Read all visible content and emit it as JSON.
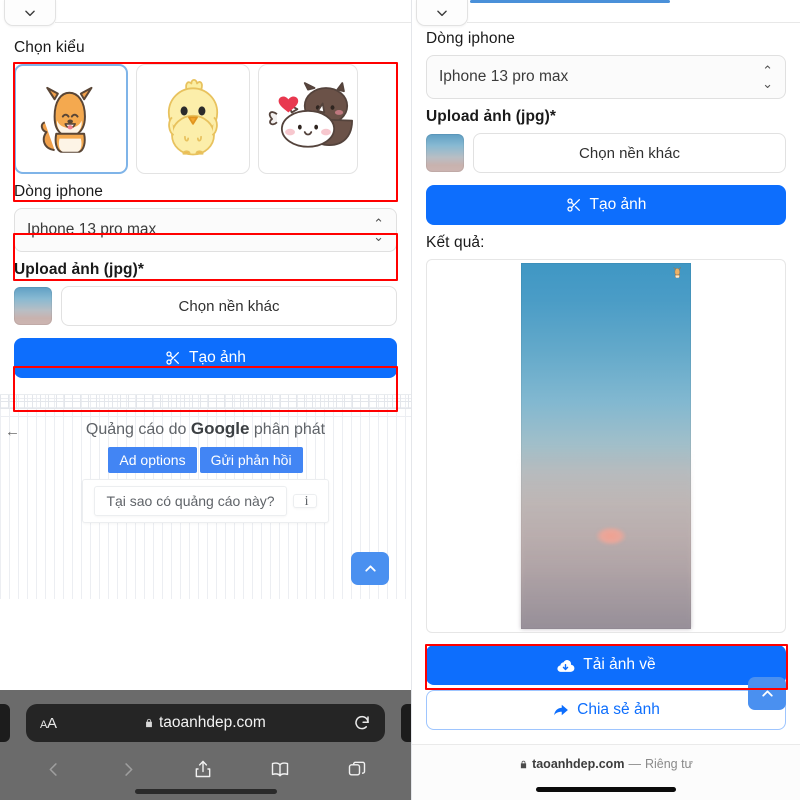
{
  "left_panel": {
    "tab": {
      "chevron_icon": "chevron-down-icon"
    },
    "style_label": "Chọn kiểu",
    "stickers": [
      {
        "name": "shiba-dog-sticker",
        "selected": true
      },
      {
        "name": "yellow-chick-sticker",
        "selected": false
      },
      {
        "name": "cat-couple-sticker",
        "selected": false
      }
    ],
    "iphone_label": "Dòng iphone",
    "iphone_value": "Iphone 13 pro max",
    "upload_label": "Upload ảnh (jpg)*",
    "choose_bg_label": "Chọn nền khác",
    "create_label": "Tạo ảnh",
    "create_icon": "scissors-icon",
    "ad": {
      "back_icon": "back-arrow-icon",
      "title_prefix": "Quảng cáo do",
      "brand": "Google",
      "title_suffix": "phân phát",
      "options_label": "Ad options",
      "feedback_label": "Gửi phản hồi",
      "why_label": "Tại sao có quảng cáo này?",
      "info_icon": "info-icon"
    },
    "scroll_top_icon": "chevron-up-icon",
    "safari": {
      "text_size_label": "AA",
      "url": "taoanhdep.com",
      "lock_icon": "lock-icon",
      "reload_icon": "reload-icon",
      "back_icon": "back-chevron-icon",
      "forward_icon": "forward-chevron-icon",
      "share_icon": "share-icon",
      "bookmarks_icon": "book-icon",
      "tabs_icon": "tabs-icon"
    }
  },
  "right_panel": {
    "tab": {
      "chevron_icon": "chevron-down-icon"
    },
    "iphone_label": "Dòng iphone",
    "iphone_value": "Iphone 13 pro max",
    "upload_label": "Upload ảnh (jpg)*",
    "choose_bg_label": "Chọn nền khác",
    "create_label": "Tạo ảnh",
    "create_icon": "scissors-icon",
    "result_label": "Kết quả:",
    "download_label": "Tải ảnh về",
    "download_icon": "cloud-download-icon",
    "share_label": "Chia sẻ ảnh",
    "share_icon": "share-arrow-icon",
    "scroll_top_icon": "chevron-up-icon",
    "footer": {
      "lock_icon": "lock-icon",
      "domain": "taoanhdep.com",
      "separator": "—",
      "privacy": "Riêng tư"
    }
  },
  "annotations": {
    "highlight_color": "#ff0000",
    "boxes": [
      "sticker-row-highlight",
      "iphone-select-highlight",
      "create-button-highlight",
      "download-button-highlight"
    ]
  },
  "colors": {
    "primary_blue": "#0d6efd",
    "google_blue": "#4285f4",
    "highlight_red": "#ff0000",
    "selected_border": "#7fb4e8"
  }
}
